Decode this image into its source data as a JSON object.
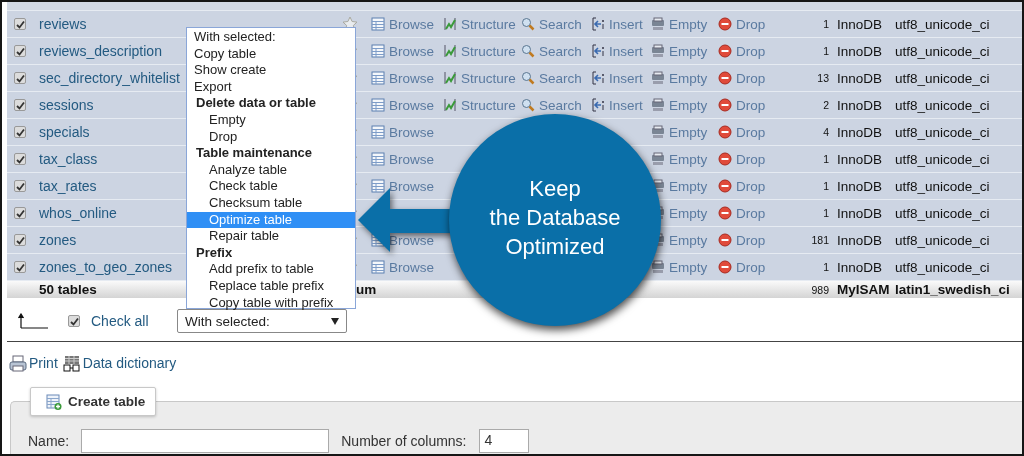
{
  "table": {
    "rows": [
      {
        "name": "reviews",
        "checked": true,
        "actions": [
          {
            "kind": "browse",
            "label": "Browse"
          },
          {
            "kind": "structure",
            "label": "Structure"
          },
          {
            "kind": "search",
            "label": "Search"
          },
          {
            "kind": "insert",
            "label": "Insert"
          },
          {
            "kind": "empty",
            "label": "Empty"
          },
          {
            "kind": "drop",
            "label": "Drop"
          }
        ],
        "rows": "1",
        "engine": "InnoDB",
        "collation": "utf8_unicode_ci"
      },
      {
        "name": "reviews_description",
        "checked": true,
        "actions": [
          {
            "kind": "browse",
            "label": "Browse"
          },
          {
            "kind": "structure",
            "label": "Structure"
          },
          {
            "kind": "search",
            "label": "Search"
          },
          {
            "kind": "insert",
            "label": "Insert"
          },
          {
            "kind": "empty",
            "label": "Empty"
          },
          {
            "kind": "drop",
            "label": "Drop"
          }
        ],
        "rows": "1",
        "engine": "InnoDB",
        "collation": "utf8_unicode_ci"
      },
      {
        "name": "sec_directory_whitelist",
        "checked": true,
        "actions": [
          {
            "kind": "browse",
            "label": "Browse"
          },
          {
            "kind": "structure",
            "label": "Structure"
          },
          {
            "kind": "search",
            "label": "Search"
          },
          {
            "kind": "insert",
            "label": "Insert"
          },
          {
            "kind": "empty",
            "label": "Empty"
          },
          {
            "kind": "drop",
            "label": "Drop"
          }
        ],
        "rows": "13",
        "engine": "InnoDB",
        "collation": "utf8_unicode_ci"
      },
      {
        "name": "sessions",
        "checked": true,
        "actions": [
          {
            "kind": "browse",
            "label": "Browse"
          },
          {
            "kind": "structure",
            "label": "Structure"
          },
          {
            "kind": "search",
            "label": "Search"
          },
          {
            "kind": "insert",
            "label": "Insert"
          },
          {
            "kind": "empty",
            "label": "Empty"
          },
          {
            "kind": "drop",
            "label": "Drop"
          }
        ],
        "rows": "2",
        "engine": "InnoDB",
        "collation": "utf8_unicode_ci"
      },
      {
        "name": "specials",
        "checked": true,
        "actions": [
          {
            "kind": "browse",
            "label": "Browse"
          },
          {
            "kind": "empty",
            "label": "Empty"
          },
          {
            "kind": "drop",
            "label": "Drop"
          }
        ],
        "rows": "4",
        "engine": "InnoDB",
        "collation": "utf8_unicode_ci"
      },
      {
        "name": "tax_class",
        "checked": true,
        "actions": [
          {
            "kind": "browse",
            "label": "Browse"
          },
          {
            "kind": "empty",
            "label": "Empty"
          },
          {
            "kind": "drop",
            "label": "Drop"
          }
        ],
        "rows": "1",
        "engine": "InnoDB",
        "collation": "utf8_unicode_ci"
      },
      {
        "name": "tax_rates",
        "checked": true,
        "actions": [
          {
            "kind": "browse",
            "label": "Browse"
          },
          {
            "kind": "empty",
            "label": "Empty"
          },
          {
            "kind": "drop",
            "label": "Drop"
          }
        ],
        "rows": "1",
        "engine": "InnoDB",
        "collation": "utf8_unicode_ci"
      },
      {
        "name": "whos_online",
        "checked": true,
        "actions": [
          {
            "kind": "empty",
            "label": "Empty"
          },
          {
            "kind": "drop",
            "label": "Drop"
          }
        ],
        "rows": "1",
        "engine": "InnoDB",
        "collation": "utf8_unicode_ci"
      },
      {
        "name": "zones",
        "checked": true,
        "actions": [
          {
            "kind": "browse",
            "label": "Browse"
          },
          {
            "kind": "empty",
            "label": "Empty"
          },
          {
            "kind": "drop",
            "label": "Drop"
          }
        ],
        "rows": "181",
        "engine": "InnoDB",
        "collation": "utf8_unicode_ci"
      },
      {
        "name": "zones_to_geo_zones",
        "checked": true,
        "actions": [
          {
            "kind": "browse",
            "label": "Browse"
          },
          {
            "kind": "empty",
            "label": "Empty"
          },
          {
            "kind": "drop",
            "label": "Drop"
          }
        ],
        "rows": "1",
        "engine": "InnoDB",
        "collation": "utf8_unicode_ci"
      }
    ],
    "footer": {
      "label": "50 tables",
      "sum_fragment": "um",
      "rows": "989",
      "engine": "MyISAM",
      "collation": "latin1_swedish_ci"
    }
  },
  "bulk_menu": {
    "options": [
      {
        "kind": "header",
        "label": "With selected:",
        "selected": false
      },
      {
        "kind": "option",
        "label": "Copy table",
        "selected": false
      },
      {
        "kind": "option",
        "label": "Show create",
        "selected": false
      },
      {
        "kind": "option",
        "label": "Export",
        "selected": false
      },
      {
        "kind": "group",
        "label": "Delete data or table",
        "selected": false
      },
      {
        "kind": "suboption",
        "label": "Empty",
        "selected": false
      },
      {
        "kind": "suboption",
        "label": "Drop",
        "selected": false
      },
      {
        "kind": "group",
        "label": "Table maintenance",
        "selected": false
      },
      {
        "kind": "suboption",
        "label": "Analyze table",
        "selected": false
      },
      {
        "kind": "suboption",
        "label": "Check table",
        "selected": false
      },
      {
        "kind": "suboption",
        "label": "Checksum table",
        "selected": false
      },
      {
        "kind": "suboption",
        "label": "Optimize table",
        "selected": true
      },
      {
        "kind": "suboption",
        "label": "Repair table",
        "selected": false
      },
      {
        "kind": "group",
        "label": "Prefix",
        "selected": false
      },
      {
        "kind": "suboption",
        "label": "Add prefix to table",
        "selected": false
      },
      {
        "kind": "suboption",
        "label": "Replace table prefix",
        "selected": false
      },
      {
        "kind": "suboption",
        "label": "Copy table with prefix",
        "selected": false
      }
    ]
  },
  "bulk_bar": {
    "check_all": {
      "label": "Check all",
      "checked": true
    },
    "select": {
      "value": "With selected:"
    }
  },
  "links": [
    {
      "kind": "print",
      "label": "Print"
    },
    {
      "kind": "dictionary",
      "label": "Data dictionary"
    }
  ],
  "create_table": {
    "legend": "Create table",
    "name_label": "Name:",
    "columns_label": "Number of columns:",
    "columns_value": "4"
  },
  "callout": {
    "lines": [
      "Keep",
      "the Database",
      "Optimized"
    ]
  }
}
